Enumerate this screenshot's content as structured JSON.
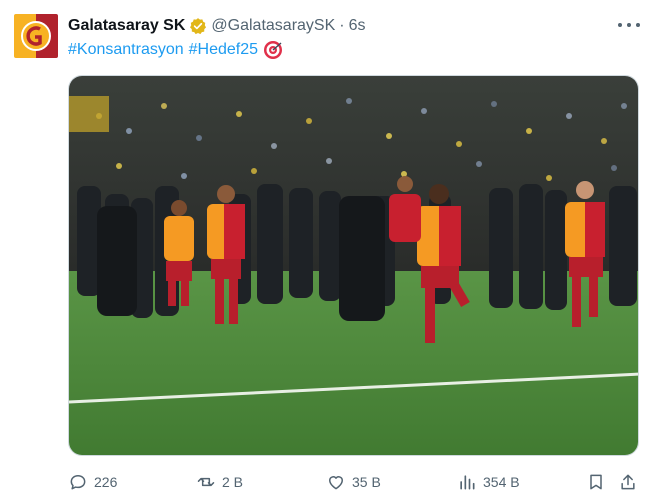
{
  "tweet": {
    "author_name": "Galatasaray SK",
    "handle": "@GalatasaraySK",
    "separator": "·",
    "time": "6s",
    "hashtags": [
      "#Konsantrasyon",
      "#Hedef25"
    ],
    "avatar_icon": "galatasaray-crest-icon",
    "verified_icon": "gold-verified-badge-icon",
    "emoji_icon": "direct-hit-target-icon",
    "media_description_icon": "photo"
  },
  "actions": {
    "replies": "226",
    "reposts": "2 B",
    "likes": "35 B",
    "views": "354 B"
  },
  "colors": {
    "link": "#1d9bf0",
    "secondary_text": "#536471",
    "verified_gold": "#e2b719",
    "club_yellow": "#f7b223",
    "club_red": "#b0222c",
    "pitch_green": "#4f8a3a"
  }
}
